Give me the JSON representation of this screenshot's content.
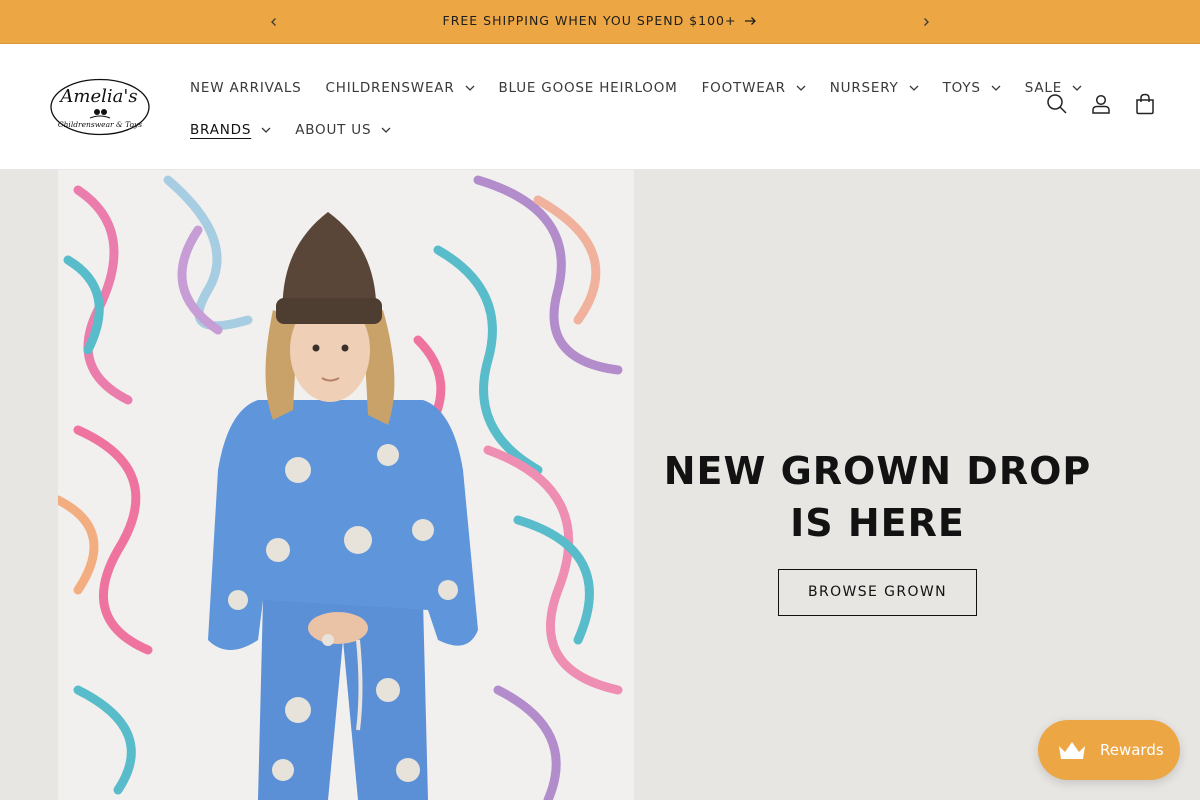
{
  "announcement": {
    "text": "FREE SHIPPING WHEN YOU SPEND $100+",
    "prev_icon": "chevron-left-icon",
    "next_icon": "chevron-right-icon"
  },
  "logo": {
    "text": "Amelia's",
    "subtext": "Childrenswear & Toys"
  },
  "nav": {
    "row1": [
      {
        "label": "NEW ARRIVALS",
        "dropdown": false
      },
      {
        "label": "CHILDRENSWEAR",
        "dropdown": true
      },
      {
        "label": "BLUE GOOSE HEIRLOOM",
        "dropdown": false
      },
      {
        "label": "FOOTWEAR",
        "dropdown": true
      },
      {
        "label": "NURSERY",
        "dropdown": true
      },
      {
        "label": "TOYS",
        "dropdown": true
      },
      {
        "label": "SALE",
        "dropdown": true
      }
    ],
    "row2": [
      {
        "label": "BRANDS",
        "dropdown": true,
        "active": true
      },
      {
        "label": "ABOUT US",
        "dropdown": true
      }
    ]
  },
  "header_icons": [
    "search-icon",
    "account-icon",
    "cart-icon"
  ],
  "hero": {
    "title": "NEW GROWN DROP IS HERE",
    "button_label": "BROWSE GROWN"
  },
  "rewards": {
    "label": "Rewards",
    "icon": "crown-icon"
  },
  "colors": {
    "accent": "#eca644",
    "hero_bg": "#e8e6e3",
    "text": "#121212"
  }
}
